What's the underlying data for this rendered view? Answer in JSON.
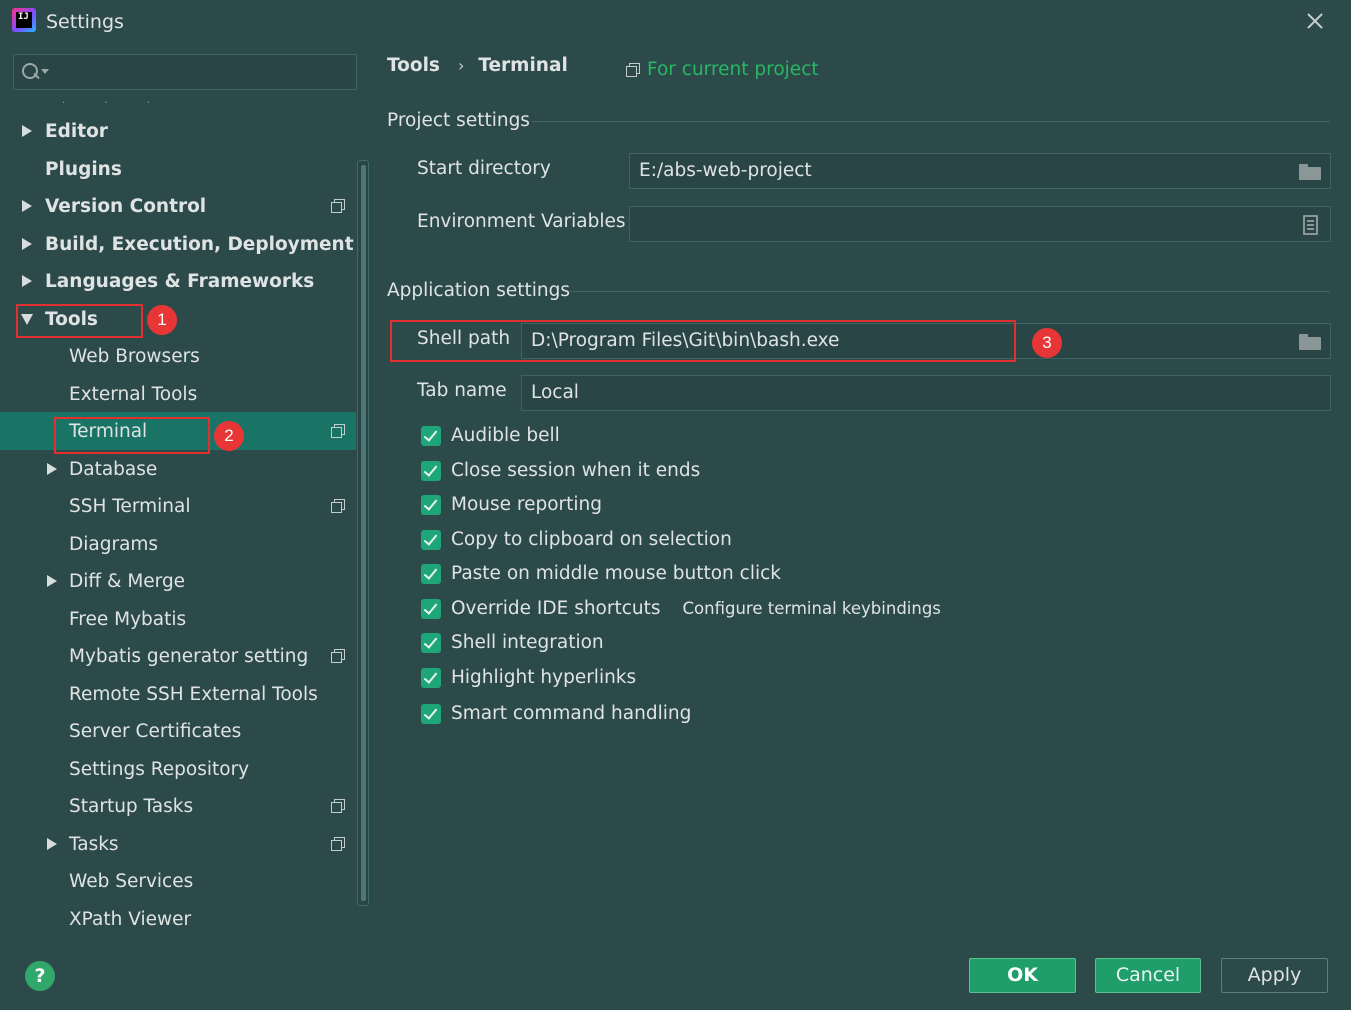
{
  "window": {
    "title": "Settings"
  },
  "search": {
    "placeholder": ""
  },
  "sidebar": {
    "items": [
      {
        "label": "Editor"
      },
      {
        "label": "Plugins"
      },
      {
        "label": "Version Control"
      },
      {
        "label": "Build, Execution, Deployment"
      },
      {
        "label": "Languages & Frameworks"
      },
      {
        "label": "Tools"
      },
      {
        "label": "Web Browsers"
      },
      {
        "label": "External Tools"
      },
      {
        "label": "Terminal"
      },
      {
        "label": "Database"
      },
      {
        "label": "SSH Terminal"
      },
      {
        "label": "Diagrams"
      },
      {
        "label": "Diff & Merge"
      },
      {
        "label": "Free Mybatis"
      },
      {
        "label": "Mybatis generator setting"
      },
      {
        "label": "Remote SSH External Tools"
      },
      {
        "label": "Server Certificates"
      },
      {
        "label": "Settings Repository"
      },
      {
        "label": "Startup Tasks"
      },
      {
        "label": "Tasks"
      },
      {
        "label": "Web Services"
      },
      {
        "label": "XPath Viewer"
      }
    ]
  },
  "annotations": {
    "a1": "1",
    "a2": "2",
    "a3": "3"
  },
  "breadcrumb": {
    "parent": "Tools",
    "separator": "›",
    "current": "Terminal"
  },
  "scope": {
    "label": "For current project"
  },
  "project_settings": {
    "header": "Project settings",
    "start_directory_label": "Start directory",
    "start_directory_value": "E:/abs-web-project",
    "env_vars_label": "Environment Variables",
    "env_vars_value": ""
  },
  "application_settings": {
    "header": "Application settings",
    "shell_path_label": "Shell path",
    "shell_path_value": "D:\\Program Files\\Git\\bin\\bash.exe",
    "tab_name_label": "Tab name",
    "tab_name_value": "Local",
    "checkboxes": [
      {
        "label": "Audible bell",
        "checked": true
      },
      {
        "label": "Close session when it ends",
        "checked": true
      },
      {
        "label": "Mouse reporting",
        "checked": true
      },
      {
        "label": "Copy to clipboard on selection",
        "checked": true
      },
      {
        "label": "Paste on middle mouse button click",
        "checked": true
      },
      {
        "label": "Override IDE shortcuts",
        "checked": true
      },
      {
        "label": "Shell integration",
        "checked": true
      },
      {
        "label": "Highlight hyperlinks",
        "checked": true
      },
      {
        "label": "Smart command handling",
        "checked": true
      }
    ],
    "keybindings_link": "Configure terminal keybindings"
  },
  "footer": {
    "help": "?",
    "ok": "OK",
    "cancel": "Cancel",
    "apply": "Apply"
  },
  "colors": {
    "background": "#2d4a4a",
    "selection": "#1a7466",
    "accent_green": "#27b862",
    "annotation_red": "#e03030"
  }
}
